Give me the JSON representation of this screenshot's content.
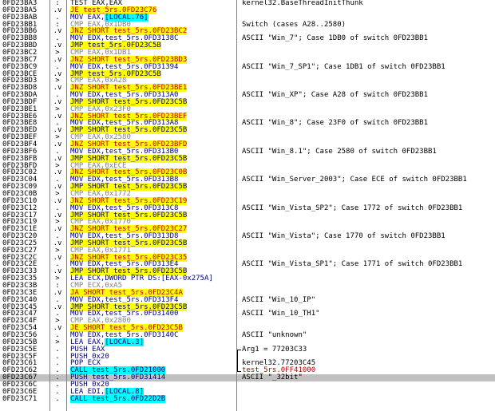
{
  "rows": [
    {
      "addr": "0FD23BA3",
      "mark": ":",
      "i": "TEST EAX,EAX",
      "k": "test",
      "c": "kernel32.BaseThreadInitThunk"
    },
    {
      "addr": "0FD23BA5",
      "mark": ".v",
      "i": "JE test_5rs.0FD23C76",
      "k": "jcc",
      "c": ""
    },
    {
      "addr": "0FD23BAB",
      "mark": ".",
      "i": "MOV EAX,",
      "h": "[LOCAL.76]",
      "k": "mov",
      "c": ""
    },
    {
      "addr": "0FD23BB1",
      "mark": ":",
      "i": "CMP EAX,0x1DB0",
      "k": "cmp",
      "c": "Switch (cases A28..2580)"
    },
    {
      "addr": "0FD23BB6",
      "mark": ".v",
      "i": "JNZ SHORT test_5rs.0FD23BC2",
      "k": "jcc",
      "c": ""
    },
    {
      "addr": "0FD23BB8",
      "mark": ".",
      "i": "MOV EDX,test_5rs.0FD3138C",
      "k": "mov",
      "c": "ASCII \"Win_7\"; Case 1DB0 of switch 0FD23BB1"
    },
    {
      "addr": "0FD23BBD",
      "mark": ".v",
      "i": "JMP test_5rs.0FD23C5B",
      "k": "jmp",
      "c": ""
    },
    {
      "addr": "0FD23BC2",
      "mark": ">",
      "i": "CMP EAX,0x1DB1",
      "k": "cmp",
      "c": ""
    },
    {
      "addr": "0FD23BC7",
      "mark": ".v",
      "i": "JNZ SHORT test_5rs.0FD23BD3",
      "k": "jcc",
      "c": ""
    },
    {
      "addr": "0FD23BC9",
      "mark": ".",
      "i": "MOV EDX,test_5rs.0FD31394",
      "k": "mov",
      "c": "ASCII \"Win_7_SP1\"; Case 1DB1 of switch 0FD23BB1"
    },
    {
      "addr": "0FD23BCE",
      "mark": ".v",
      "i": "JMP test_5rs.0FD23C5B",
      "k": "jmp",
      "c": ""
    },
    {
      "addr": "0FD23BD3",
      "mark": ">",
      "i": "CMP EAX,0xA28",
      "k": "cmp",
      "c": ""
    },
    {
      "addr": "0FD23BD8",
      "mark": ".v",
      "i": "JNZ SHORT test_5rs.0FD23BE1",
      "k": "jcc",
      "c": ""
    },
    {
      "addr": "0FD23BDA",
      "mark": ".",
      "i": "MOV EDX,test_5rs.0FD313A0",
      "k": "mov",
      "c": "ASCII \"Win_XP\"; Case A28 of switch 0FD23BB1"
    },
    {
      "addr": "0FD23BDF",
      "mark": ".v",
      "i": "JMP SHORT test_5rs.0FD23C5B",
      "k": "jmp",
      "c": ""
    },
    {
      "addr": "0FD23BE1",
      "mark": ">",
      "i": "CMP EAX,0x23F0",
      "k": "cmp",
      "c": ""
    },
    {
      "addr": "0FD23BE6",
      "mark": ".v",
      "i": "JNZ SHORT test_5rs.0FD23BEF",
      "k": "jcc",
      "c": ""
    },
    {
      "addr": "0FD23BE8",
      "mark": ".",
      "i": "MOV EDX,test_5rs.0FD313A8",
      "k": "mov",
      "c": "ASCII \"Win_8\"; Case 23F0 of switch 0FD23BB1"
    },
    {
      "addr": "0FD23BED",
      "mark": ".v",
      "i": "JMP SHORT test_5rs.0FD23C5B",
      "k": "jmp",
      "c": ""
    },
    {
      "addr": "0FD23BEF",
      "mark": ">",
      "i": "CMP EAX,0x2580",
      "k": "cmp",
      "c": ""
    },
    {
      "addr": "0FD23BF4",
      "mark": ".v",
      "i": "JNZ SHORT test_5rs.0FD23BFD",
      "k": "jcc",
      "c": ""
    },
    {
      "addr": "0FD23BF6",
      "mark": ".",
      "i": "MOV EDX,test_5rs.0FD313B0",
      "k": "mov",
      "c": "ASCII \"Win_8.1\"; Case 2580 of switch 0FD23BB1"
    },
    {
      "addr": "0FD23BFB",
      "mark": ".v",
      "i": "JMP SHORT test_5rs.0FD23C5B",
      "k": "jmp",
      "c": ""
    },
    {
      "addr": "0FD23BFD",
      "mark": ">",
      "i": "CMP EAX,0xECE",
      "k": "cmp",
      "c": ""
    },
    {
      "addr": "0FD23C02",
      "mark": ".v",
      "i": "JNZ SHORT test_5rs.0FD23C0B",
      "k": "jcc",
      "c": ""
    },
    {
      "addr": "0FD23C04",
      "mark": ".",
      "i": "MOV EDX,test_5rs.0FD313B8",
      "k": "mov",
      "c": "ASCII \"Win_Server_2003\"; Case ECE of switch 0FD23BB1"
    },
    {
      "addr": "0FD23C09",
      "mark": ".v",
      "i": "JMP SHORT test_5rs.0FD23C5B",
      "k": "jmp",
      "c": ""
    },
    {
      "addr": "0FD23C0B",
      "mark": ">",
      "i": "CMP EAX,0x1772",
      "k": "cmp",
      "c": ""
    },
    {
      "addr": "0FD23C10",
      "mark": ".v",
      "i": "JNZ SHORT test_5rs.0FD23C19",
      "k": "jcc",
      "c": ""
    },
    {
      "addr": "0FD23C12",
      "mark": ".",
      "i": "MOV EDX,test_5rs.0FD313C8",
      "k": "mov",
      "c": "ASCII \"Win_Vista_SP2\"; Case 1772 of switch 0FD23BB1"
    },
    {
      "addr": "0FD23C17",
      "mark": ".v",
      "i": "JMP SHORT test_5rs.0FD23C5B",
      "k": "jmp",
      "c": ""
    },
    {
      "addr": "0FD23C19",
      "mark": ">",
      "i": "CMP EAX,0x1770",
      "k": "cmp",
      "c": ""
    },
    {
      "addr": "0FD23C1E",
      "mark": ".v",
      "i": "JNZ SHORT test_5rs.0FD23C27",
      "k": "jcc",
      "c": ""
    },
    {
      "addr": "0FD23C20",
      "mark": ".",
      "i": "MOV EDX,test_5rs.0FD313D8",
      "k": "mov",
      "c": "ASCII \"Win_Vista\"; Case 1770 of switch 0FD23BB1"
    },
    {
      "addr": "0FD23C25",
      "mark": ".v",
      "i": "JMP SHORT test_5rs.0FD23C5B",
      "k": "jmp",
      "c": ""
    },
    {
      "addr": "0FD23C27",
      "mark": ">",
      "i": "CMP EAX,0x1771",
      "k": "cmp",
      "c": ""
    },
    {
      "addr": "0FD23C2C",
      "mark": ".v",
      "i": "JNZ SHORT test_5rs.0FD23C35",
      "k": "jcc",
      "c": ""
    },
    {
      "addr": "0FD23C2E",
      "mark": ".",
      "i": "MOV EDX,test_5rs.0FD313E4",
      "k": "mov",
      "c": "ASCII \"Win_Vista_SP1\"; Case 1771 of switch 0FD23BB1"
    },
    {
      "addr": "0FD23C33",
      "mark": ".v",
      "i": "JMP SHORT test_5rs.0FD23C5B",
      "k": "jmp",
      "c": ""
    },
    {
      "addr": "0FD23C35",
      "mark": ">",
      "i": "LEA ECX,DWORD PTR DS:[EAX-0x275A]",
      "k": "lea",
      "c": ""
    },
    {
      "addr": "0FD23C3B",
      "mark": ":",
      "i": "CMP ECX,0xA5",
      "k": "cmp",
      "c": ""
    },
    {
      "addr": "0FD23C3E",
      "mark": ".v",
      "i": "JA SHORT test_5rs.0FD23C4A",
      "k": "jcc",
      "c": ""
    },
    {
      "addr": "0FD23C40",
      "mark": ".",
      "i": "MOV EDX,test_5rs.0FD313F4",
      "k": "mov",
      "c": "ASCII \"Win_10_IP\""
    },
    {
      "addr": "0FD23C45",
      "mark": ".v",
      "i": "JMP SHORT test_5rs.0FD23C5B",
      "k": "jmp",
      "c": ""
    },
    {
      "addr": "0FD23C47",
      "mark": ".",
      "i": "MOV EDX,test_5rs.0FD31400",
      "k": "mov",
      "c": "ASCII \"Win_10_TH1\""
    },
    {
      "addr": "0FD23C4F",
      "mark": ">",
      "i": "CMP EAX,0x2800",
      "k": "cmp",
      "c": ""
    },
    {
      "addr": "0FD23C54",
      "mark": ".v",
      "i": "JE SHORT test_5rs.0FD23C5B",
      "k": "jcc",
      "c": ""
    },
    {
      "addr": "0FD23C56",
      "mark": ".",
      "i": "MOV EDX,test_5rs.0FD3140C",
      "k": "mov",
      "c": "ASCII \"unknown\""
    },
    {
      "addr": "0FD23C5B",
      "mark": ">",
      "i": "LEA EAX,",
      "h": "[LOCAL.3]",
      "k": "lea",
      "c": ""
    },
    {
      "addr": "0FD23C5E",
      "mark": ".",
      "i": "PUSH EAX",
      "k": "push",
      "c": "Arg1 = 77203C33",
      "brk": "top"
    },
    {
      "addr": "0FD23C5F",
      "mark": ".",
      "i": "PUSH 0x20",
      "k": "push",
      "c": ""
    },
    {
      "addr": "0FD23C61",
      "mark": ".",
      "i": "POP ECX",
      "k": "pop",
      "c": "kernel32.77203C45"
    },
    {
      "addr": "0FD23C62",
      "mark": ".",
      "i": "CALL test_5rs.0FD21000",
      "k": "call",
      "c": "test_5rs.0FF41000",
      "cred": true
    },
    {
      "addr": "0FD23C67",
      "mark": ".",
      "i": "PUSH test_5rs.0FD31414",
      "k": "push",
      "c": "ASCII \"_32bit\"",
      "sel": true
    },
    {
      "addr": "0FD23C6C",
      "mark": ".",
      "i": "PUSH 0x20",
      "k": "push",
      "c": ""
    },
    {
      "addr": "0FD23C6E",
      "mark": ".",
      "i": "LEA EDI,",
      "h": "[LOCAL.8]",
      "k": "lea",
      "c": ""
    },
    {
      "addr": "0FD23C71",
      "mark": ".",
      "i": "CALL test_5rs.0FD22D2B",
      "k": "call",
      "c": ""
    }
  ]
}
